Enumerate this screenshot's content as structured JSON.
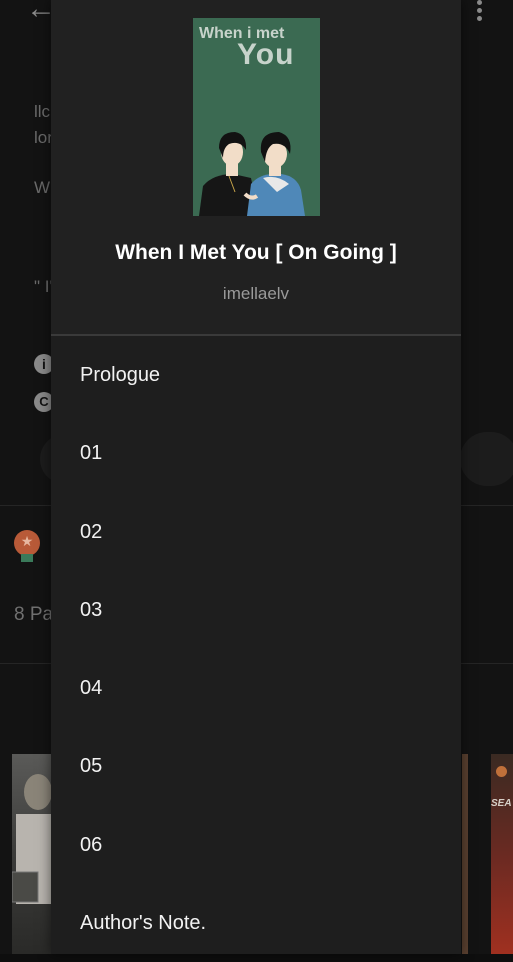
{
  "background": {
    "text_lines": [
      "llc",
      "lor",
      "W",
      "\" I'"
    ],
    "info_glyph": "i",
    "copyright_glyph": "C",
    "parts_text": "8 Pa",
    "thumb_text": "SEA",
    "icons": [
      "back-arrow-icon",
      "more-vertical-icon",
      "info-icon",
      "copyright-icon",
      "award-badge-icon"
    ]
  },
  "drawer": {
    "cover": {
      "line1": "When i met",
      "line2": "You"
    },
    "title": "When I Met You [ On Going ]",
    "author": "imellaelv",
    "chapters": [
      "Prologue",
      "01",
      "02",
      "03",
      "04",
      "05",
      "06",
      "Author's Note."
    ]
  },
  "colors": {
    "drawer_bg": "#1e1e1e",
    "header_bg": "#212121",
    "cover_green": "#3b6a52",
    "text_primary": "#ffffff",
    "text_secondary": "#9a9a9a"
  }
}
